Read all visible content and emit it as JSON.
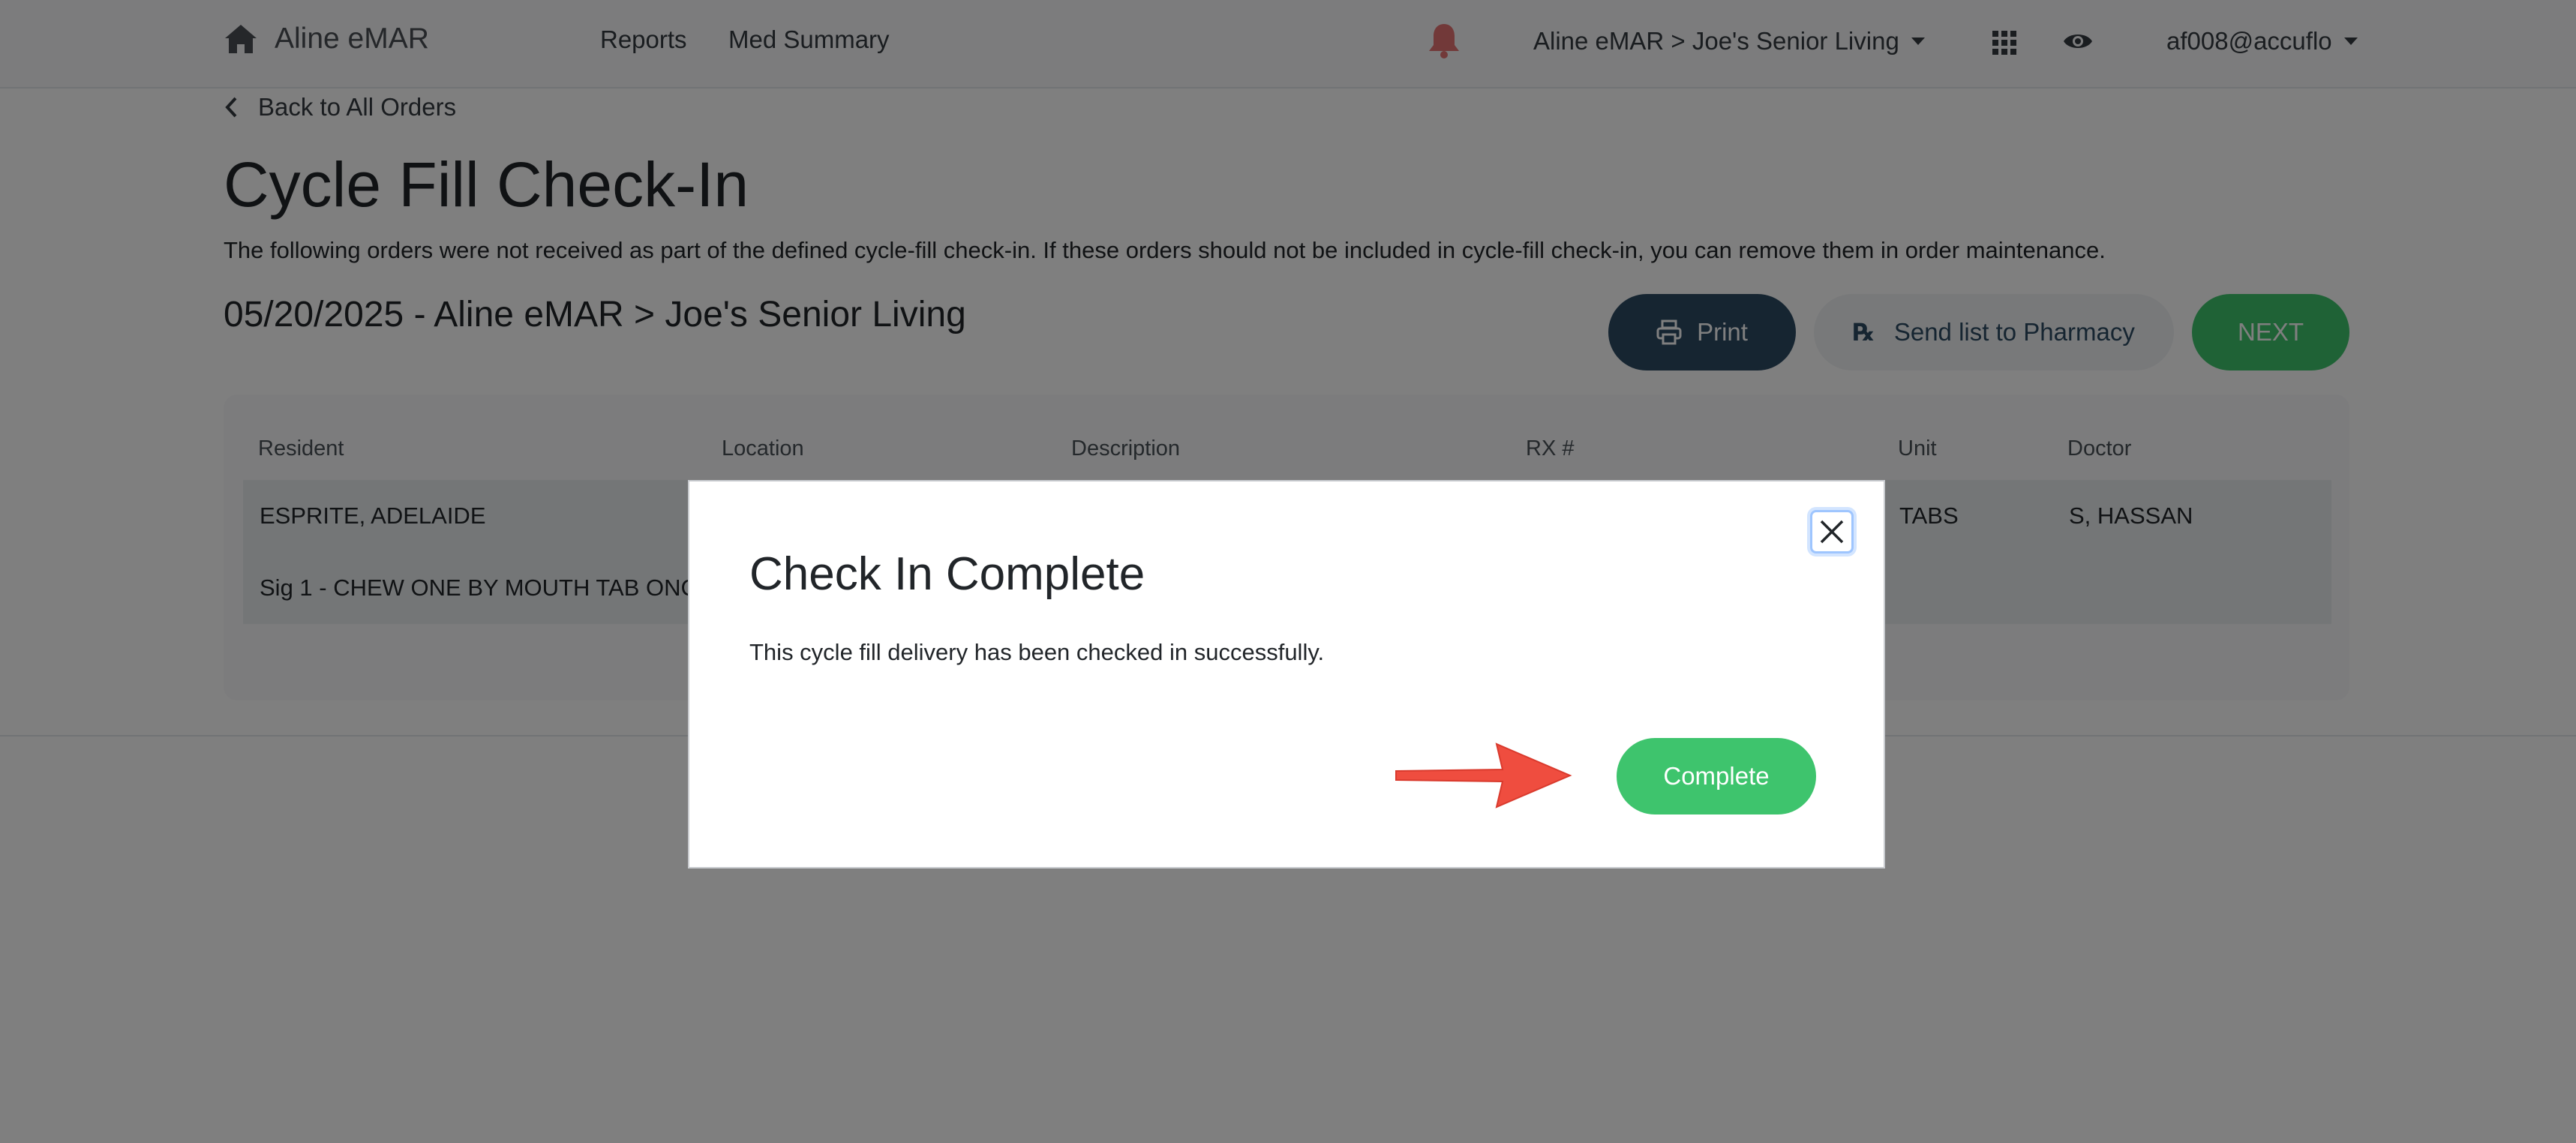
{
  "navbar": {
    "brand": "Aline eMAR",
    "links": [
      "Reports",
      "Med Summary"
    ],
    "facility": "Aline eMAR > Joe's Senior Living",
    "user": "af008@accuflo"
  },
  "page": {
    "back_link": "Back to All Orders",
    "title": "Cycle Fill Check-In",
    "description": "The following orders were not received as part of the defined cycle-fill check-in. If these orders should not be included in cycle-fill check-in, you can remove them in order maintenance.",
    "subheading": "05/20/2025 - Aline eMAR > Joe's Senior Living",
    "buttons": {
      "print": "Print",
      "pharmacy_rx": "℞",
      "pharmacy": "Send list to Pharmacy",
      "next": "NEXT"
    }
  },
  "table": {
    "headers": [
      "Resident",
      "Location",
      "Description",
      "RX #",
      "Unit",
      "Doctor"
    ],
    "rows": [
      {
        "resident": "ESPRITE, ADELAIDE",
        "unit": "TABS",
        "doctor": "S, HASSAN",
        "sig": "Sig 1 - CHEW ONE BY MOUTH TAB ONC"
      }
    ]
  },
  "modal": {
    "title": "Check In Complete",
    "body": "This cycle fill delivery has been checked in successfully.",
    "complete_button": "Complete"
  },
  "colors": {
    "primary_dark": "#2c4a63",
    "success": "#3ec46d",
    "annotation_arrow": "#ef4d3f",
    "bell": "#e57373"
  },
  "icons": [
    "home-icon",
    "bell-icon",
    "grid-icon",
    "eye-icon",
    "chevron-left-icon",
    "printer-icon",
    "close-icon",
    "arrow-annotation"
  ]
}
